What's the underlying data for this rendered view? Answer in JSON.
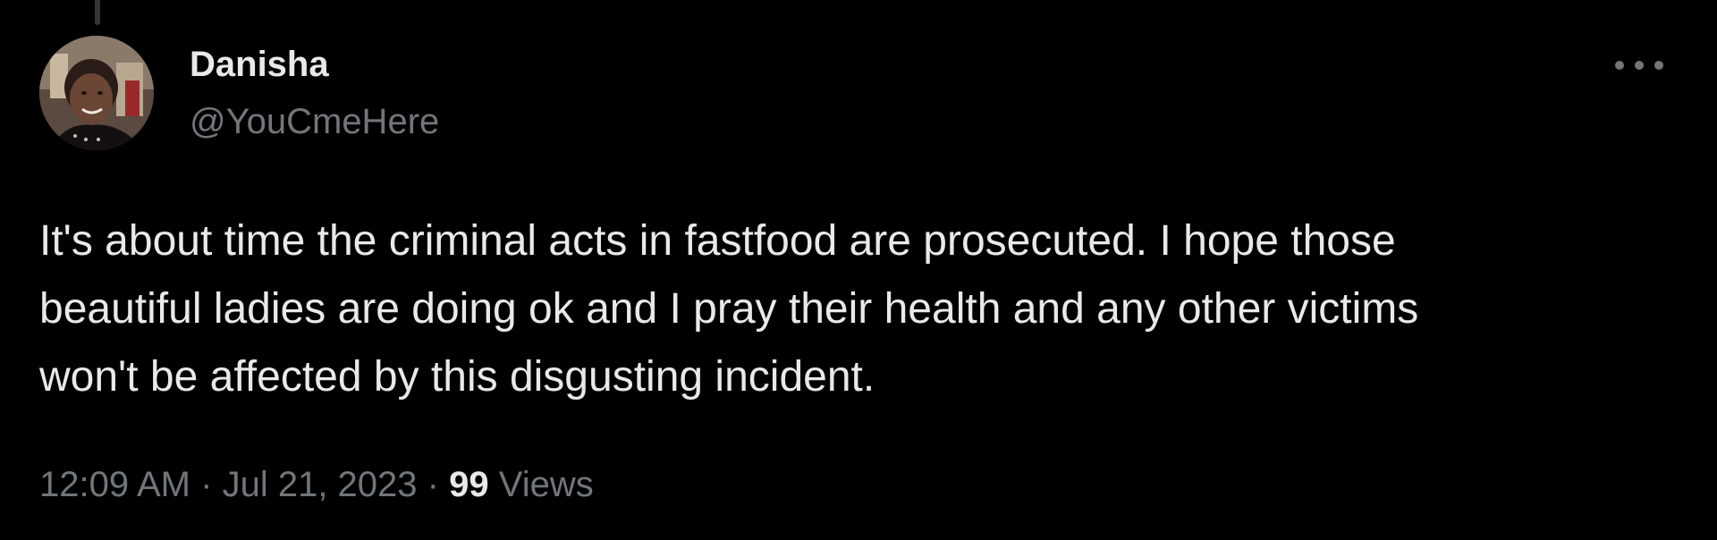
{
  "theme": {
    "background": "#000000",
    "primary_text": "#e7e9ea",
    "secondary_text": "#71767b"
  },
  "author": {
    "display_name": "Danisha",
    "handle": "@YouCmeHere",
    "avatar_icon": "profile-photo"
  },
  "menu": {
    "icon": "more-horizontal-icon"
  },
  "tweet": {
    "text": "It's about time the criminal acts in fastfood are prosecuted. I hope those\nbeautiful ladies are doing ok and I pray their health and any other victims\nwon't be affected by this disgusting incident."
  },
  "meta": {
    "time": "12:09 AM",
    "separator": "·",
    "date": "Jul 21, 2023",
    "views_count": "99",
    "views_label": "Views"
  }
}
